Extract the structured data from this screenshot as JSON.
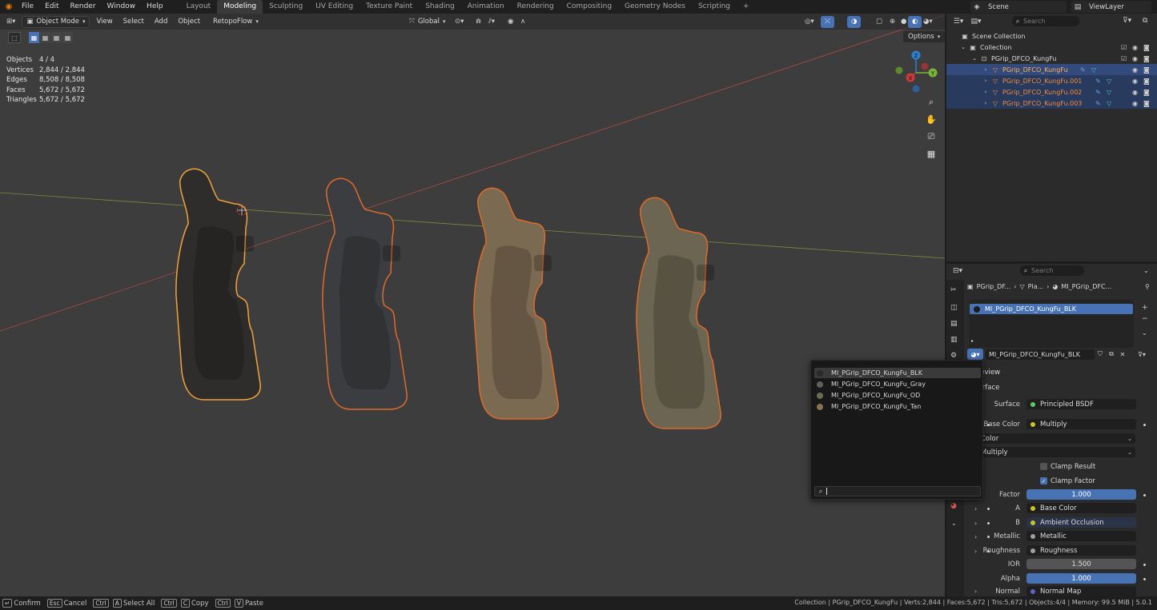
{
  "topbar": {
    "menus": [
      "File",
      "Edit",
      "Render",
      "Window",
      "Help"
    ],
    "workspaces": [
      "Layout",
      "Modeling",
      "Sculpting",
      "UV Editing",
      "Texture Paint",
      "Shading",
      "Animation",
      "Rendering",
      "Compositing",
      "Geometry Nodes",
      "Scripting"
    ],
    "active_workspace": "Modeling",
    "add_tab": "+",
    "scene": "Scene",
    "view_layer": "ViewLayer"
  },
  "viewport": {
    "mode": "Object Mode",
    "menus": [
      "View",
      "Select",
      "Add",
      "Object"
    ],
    "addon_menu": "RetopoFlow",
    "transform_orientation": "Global",
    "options_label": "Options",
    "stats": [
      {
        "label": "Objects",
        "value": "4 / 4"
      },
      {
        "label": "Vertices",
        "value": "2,844 / 2,844"
      },
      {
        "label": "Edges",
        "value": "8,508 / 8,508"
      },
      {
        "label": "Faces",
        "value": "5,672 / 5,672"
      },
      {
        "label": "Triangles",
        "value": "5,672 / 5,672"
      }
    ],
    "gizmo": {
      "x": "X",
      "y": "Y",
      "z": "Z"
    }
  },
  "outliner": {
    "search_placeholder": "Search",
    "scene_collection": "Scene Collection",
    "collection": "Collection",
    "parent": "PGrip_DFCO_KungFu",
    "items": [
      "PGrip_DFCO_KungFu",
      "PGrip_DFCO_KungFu.001",
      "PGrip_DFCO_KungFu.002",
      "PGrip_DFCO_KungFu.003"
    ]
  },
  "properties": {
    "search_placeholder": "Search",
    "breadcrumb": [
      "PGrip_DF...",
      "Pla...",
      "MI_PGrip_DFC..."
    ],
    "slot_name": "MI_PGrip_DFCO_KungFu_BLK",
    "material_name": "MI_PGrip_DFCO_KungFu_BLK",
    "sections": {
      "preview": "Preview",
      "surface": "Surface"
    },
    "rows": {
      "surface": {
        "label": "Surface",
        "value": "Principled BSDF"
      },
      "base_color": {
        "label": "Base Color",
        "value": "Multiply"
      },
      "color_dropdown": "Color",
      "multiply_dropdown": "Multiply",
      "clamp_result": "Clamp Result",
      "clamp_factor": "Clamp Factor",
      "factor": {
        "label": "Factor",
        "value": "1.000"
      },
      "a": {
        "label": "A",
        "value": "Base Color"
      },
      "b": {
        "label": "B",
        "value": "Ambient Occlusion"
      },
      "metallic": {
        "label": "Metallic",
        "value": "Metallic"
      },
      "roughness": {
        "label": "Roughness",
        "value": "Roughness"
      },
      "ior": {
        "label": "IOR",
        "value": "1.500"
      },
      "alpha": {
        "label": "Alpha",
        "value": "1.000"
      },
      "normal": {
        "label": "Normal",
        "value": "Normal Map"
      }
    }
  },
  "popup": {
    "items": [
      {
        "name": "MI_PGrip_DFCO_KungFu_BLK",
        "color": "#2a2a2a"
      },
      {
        "name": "MI_PGrip_DFCO_KungFu_Gray",
        "color": "#5e5e5e"
      },
      {
        "name": "MI_PGrip_DFCO_KungFu_OD",
        "color": "#6f6a52"
      },
      {
        "name": "MI_PGrip_DFCO_KungFu_Tan",
        "color": "#8a7152"
      }
    ]
  },
  "grips": [
    {
      "fill": "#2f2d2b",
      "outline": "#f2a23a"
    },
    {
      "fill": "#3b3d40",
      "outline": "#e06a2a"
    },
    {
      "fill": "#7b6a52",
      "outline": "#e06a2a"
    },
    {
      "fill": "#6b6551",
      "outline": "#e06a2a"
    }
  ],
  "status": {
    "hints": [
      {
        "keys": [
          "↵"
        ],
        "text": "Confirm"
      },
      {
        "keys": [
          "Esc"
        ],
        "text": "Cancel"
      },
      {
        "keys": [
          "Ctrl",
          "A"
        ],
        "text": "Select All"
      },
      {
        "keys": [
          "Ctrl",
          "C"
        ],
        "text": "Copy"
      },
      {
        "keys": [
          "Ctrl",
          "V"
        ],
        "text": "Paste"
      }
    ],
    "right": "Collection | PGrip_DFCO_KungFu | Verts:2,844 | Faces:5,672 | Tris:5,672 | Objects:4/4 | Memory: 99.5 MiB | 5.0.1"
  }
}
